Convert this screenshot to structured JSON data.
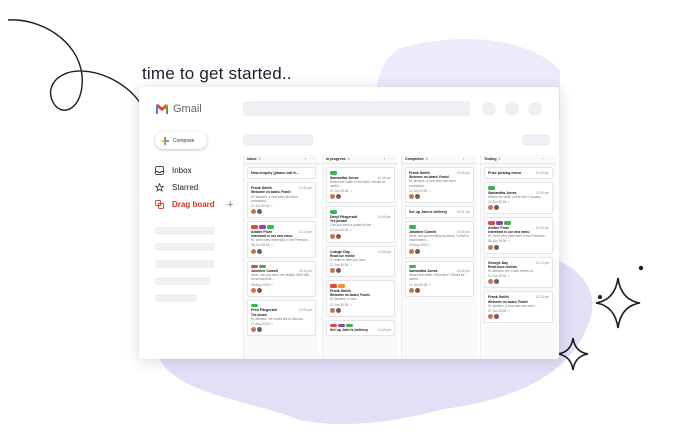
{
  "headline": "time to get started..",
  "app": {
    "name": "Gmail"
  },
  "compose": {
    "label": "Compose"
  },
  "nav": {
    "inbox": "Inbox",
    "starred": "Starred",
    "dragboard": "Drag board",
    "add_symbol": "+"
  },
  "colors": {
    "accent": "#d93025",
    "link": "#3d7be0",
    "decor_lavender": "#e4def7",
    "tag_red": "#e5493a",
    "tag_purple": "#8e44ad",
    "tag_green": "#3cb54a",
    "tag_orange": "#f2932b"
  },
  "columns": [
    {
      "title": "Inbox",
      "count": "5",
      "actions": "+ ···",
      "cards": [
        {
          "who": "New enquiry (phone call fr...",
          "time": "",
          "subj": "",
          "snip": "",
          "meta": ""
        },
        {
          "who": "Frank Smith",
          "time": "12:45 pm",
          "subj": "Welcome on board, Frank!",
          "snip": "Hi Jasmine, a new sale has been scheduled...",
          "meta": "27 Jun   20:04   ☆"
        },
        {
          "tags": [
            "red",
            "purple",
            "green"
          ],
          "who": "Amber Fiore",
          "time": "12:14 pm",
          "subj": "Interested in our new menu",
          "snip": "Hi, we're very interested in the Premium...",
          "meta": "08 Jun   20:04   ☆"
        },
        {
          "tags": [
            "red",
            "green"
          ],
          "who": "Jasmine Cowell",
          "time": "12:11 pm",
          "subj": "",
          "snip": "Hello, can you send me details. We'd like to recommend ...",
          "meta": "29 Aug   20:04   ☆"
        },
        {
          "tags": [
            "green"
          ],
          "who": "Fred Fitzgerald",
          "time": "12:09 pm",
          "subj": "The phone",
          "snip": "Hi Jasmine, we would like to discuss...",
          "meta": "17 Aug   20:04   ☆"
        }
      ]
    },
    {
      "title": "In progress",
      "count": "4",
      "actions": "+ ···",
      "cards": [
        {
          "tags": [
            "green"
          ],
          "who": "Samantha Jones",
          "time": "12:45 pm",
          "subj": "",
          "snip": "Where the width of this item? Would be useful...",
          "meta": "27 Jun   20:04   ☆"
        },
        {
          "tags": [
            "green"
          ],
          "who": "Daryl Fitzgerald",
          "time": "12:40 pm",
          "subj": "Yes please!",
          "snip": "Can you send a quote for the ...",
          "meta": "12 Jun   20:04   ☆"
        },
        {
          "who": "Cutege Day",
          "time": "10:39 pm",
          "subj": "Read our review",
          "snip": "If I want to offer you new...",
          "meta": "12 Jun   20:04   ☆"
        },
        {
          "tags": [
            "red",
            "orange"
          ],
          "who": "Frank Smith",
          "time": "",
          "subj": "Welcome on board, Frank!",
          "snip": "Hi Jasmine, a new...",
          "meta": "12 Jun   20:04   ☆"
        },
        {
          "tags": [
            "red",
            "purple",
            "green"
          ],
          "who": "Set up John's delivery",
          "time": "12:45 pm",
          "subj": "",
          "snip": "",
          "meta": ""
        }
      ]
    },
    {
      "title": "Completed",
      "count": "5",
      "actions": "+ ···",
      "cards": [
        {
          "who": "Frank Smith",
          "time": "12:45 pm",
          "subj": "Welcome on board, Frank!",
          "snip": "Hi Jasmine, a new sale has been scheduled...",
          "meta": "12 Jun   20:04   ☆"
        },
        {
          "who": "Set up John's delivery",
          "time": "12:41 pm",
          "subj": "",
          "snip": "",
          "meta": ""
        },
        {
          "tags": [
            "green"
          ],
          "who": "Jasmine Cowell",
          "time": "12:45 pm",
          "subj": "",
          "snip": "Hello, are you sending my setup. I'd like to recommend ...",
          "meta": "29 Aug   20:04   ☆"
        },
        {
          "tags": [
            "green"
          ],
          "who": "Samantha Jones",
          "time": "12:40 pm",
          "subj": "",
          "snip": "Where the width of this item? Would be useful...",
          "meta": "12 Jun   20:04   ☆"
        }
      ]
    },
    {
      "title": "Testing",
      "count": "5",
      "actions": "+ ···",
      "cards": [
        {
          "who": "Price picking menu",
          "time": "12:45 pm",
          "subj": "",
          "snip": "",
          "meta": ""
        },
        {
          "tags": [
            "green"
          ],
          "who": "Samantha Jones",
          "time": "12:45 pm",
          "subj": "",
          "snip": "Where the width of this item? Usually ...",
          "meta": "12 Jun   20:04   ☆"
        },
        {
          "tags": [
            "red",
            "purple",
            "green"
          ],
          "who": "Amber Fiore",
          "time": "12:36 pm",
          "subj": "Interested in our new menu",
          "snip": "Hi, we're very interested in the Premium...",
          "meta": "08 Jun   20:04   ☆"
        },
        {
          "who": "George Day",
          "time": "12:12 pm",
          "subj": "Read more reviews",
          "snip": "Hi Jasmine, the 5 star review of...",
          "meta": "12 Jun   20:04   ☆"
        },
        {
          "who": "Frank Smith",
          "time": "12:10 pm",
          "subj": "Welcome on board, Frank!",
          "snip": "Hi Jasmine, a new sale has been...",
          "meta": "27 Jun   20:04   ☆"
        }
      ]
    }
  ]
}
